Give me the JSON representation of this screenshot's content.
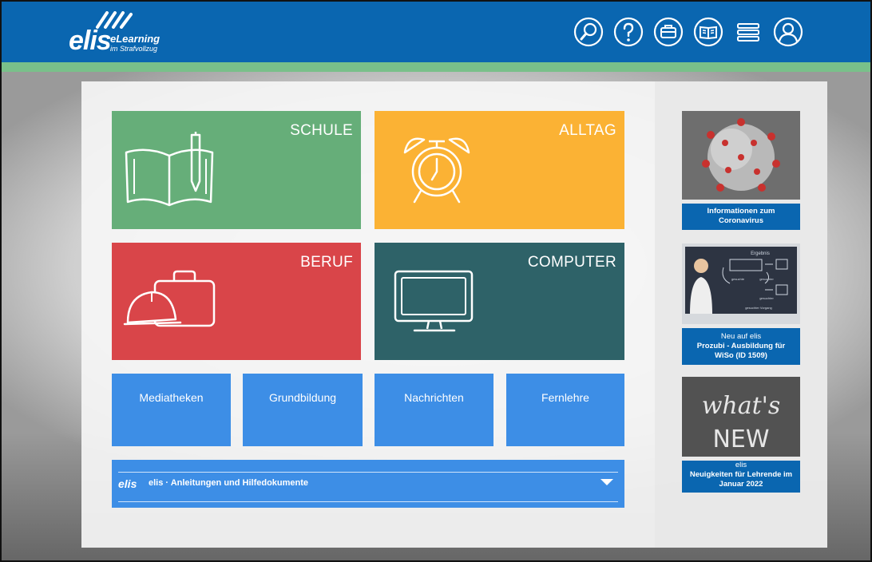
{
  "header": {
    "logo_main": "elis",
    "logo_sub1": "eLearning",
    "logo_sub2": "im Strafvollzug",
    "icons": [
      "search-icon",
      "help-icon",
      "briefcase-icon",
      "book-icon",
      "menu-icon",
      "user-icon"
    ]
  },
  "tiles": {
    "schule": "SCHULE",
    "alltag": "ALLTAG",
    "beruf": "BERUF",
    "computer": "COMPUTER"
  },
  "small_tiles": [
    "Mediatheken",
    "Grundbildung",
    "Nachrichten",
    "Fernlehre"
  ],
  "accordion": {
    "logo": "elis",
    "label": "elis · Anleitungen und Hilfedokumente"
  },
  "cards": [
    {
      "lines": [
        "Informationen zum",
        "Coronavirus"
      ]
    },
    {
      "lines": [
        "Neu auf elis",
        "Prozubi - Ausbildung für",
        "WiSo (ID 1509)"
      ],
      "image_text": [
        "Ergebnis",
        "gesuchte",
        "gesuchter",
        "gesuchter",
        "gesuchter Vorgang"
      ]
    },
    {
      "lines": [
        "elis",
        "Neuigkeiten für Lehrende im",
        "Januar 2022"
      ],
      "image_text": [
        "what's",
        "NEW"
      ]
    }
  ],
  "colors": {
    "header": "#0a66b0",
    "strip": "#79c08a",
    "schule": "#66ae79",
    "alltag": "#fbb234",
    "beruf": "#d94549",
    "computer": "#2e6268",
    "small_tile": "#3d8ee6"
  }
}
